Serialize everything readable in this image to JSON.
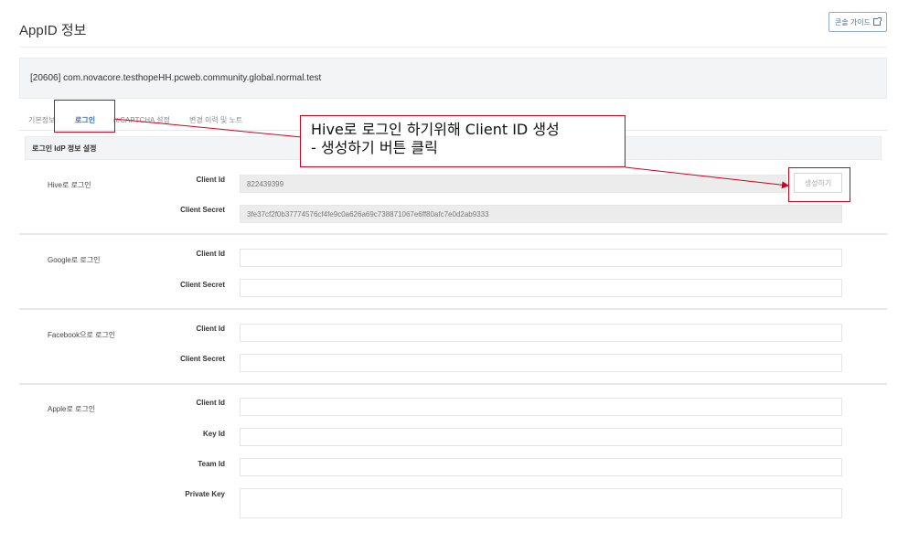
{
  "page": {
    "title": "AppID 정보",
    "guide_label": "콘솔 가이드"
  },
  "app_id_text": "[20606] com.novacore.testhopeHH.pcweb.community.global.normal.test",
  "tabs": [
    {
      "label": "기본정보"
    },
    {
      "label": "로그인"
    },
    {
      "label": "reCAPTCHA 설정"
    },
    {
      "label": "변경 이력 및 노트"
    }
  ],
  "section": {
    "title": "로그인 IdP 정보 설정"
  },
  "providers": {
    "hive": {
      "label": "Hive로 로그인",
      "client_id_label": "Client Id",
      "client_id_value": "822439399",
      "client_secret_label": "Client Secret",
      "client_secret_value": "3fe37cf2f0b37774576cf4fe9c0a626a69c738871067e6ff80afc7e0d2ab9333",
      "generate_label": "생성하기"
    },
    "google": {
      "label": "Google로 로그인",
      "client_id_label": "Client Id",
      "client_secret_label": "Client Secret"
    },
    "facebook": {
      "label": "Facebook으로 로그인",
      "client_id_label": "Client Id",
      "client_secret_label": "Client Secret"
    },
    "apple": {
      "label": "Apple로 로그인",
      "client_id_label": "Client Id",
      "key_id_label": "Key Id",
      "team_id_label": "Team Id",
      "private_key_label": "Private Key"
    }
  },
  "annotation": {
    "line1": "Hive로 로그인 하기위해 Client ID 생성",
    "line2": "- 생성하기 버튼 클릭",
    "color": "#d0021b"
  },
  "colors": {
    "accent": "#3d6fb4",
    "highlight": "#d0021b"
  },
  "icons": {
    "guide": "external-link-icon"
  }
}
